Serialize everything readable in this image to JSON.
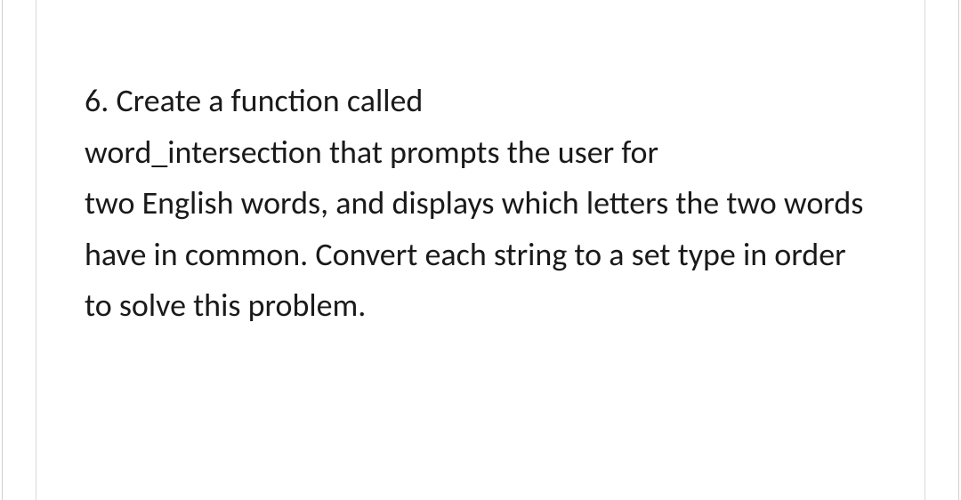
{
  "question": {
    "number": "6.",
    "line1": "Create a function called",
    "line2": "word_intersection that prompts the user for",
    "line3": "two English words, and displays which letters the two words have in common. Convert each string to a set type in order to solve this problem."
  }
}
